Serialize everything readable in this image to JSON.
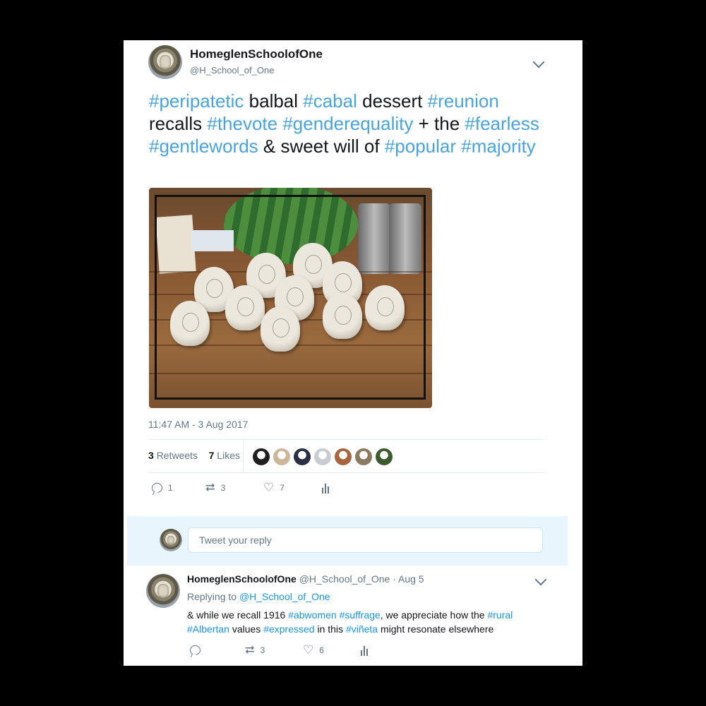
{
  "tweet": {
    "display_name": "HomeglenSchoolofOne",
    "handle": "@H_School_of_One",
    "text_parts": [
      {
        "t": "#peripatetic",
        "ht": true
      },
      {
        "t": " balbal ",
        "ht": false
      },
      {
        "t": "#cabal",
        "ht": true
      },
      {
        "t": " dessert ",
        "ht": false
      },
      {
        "t": "#reunion",
        "ht": true
      },
      {
        "t": " recalls ",
        "ht": false
      },
      {
        "t": "#thevote",
        "ht": true
      },
      {
        "t": " ",
        "ht": false
      },
      {
        "t": "#genderequality",
        "ht": true
      },
      {
        "t": " + the ",
        "ht": false
      },
      {
        "t": "#fearless",
        "ht": true
      },
      {
        "t": " ",
        "ht": false
      },
      {
        "t": "#gentlewords",
        "ht": true
      },
      {
        "t": " & sweet will of ",
        "ht": false
      },
      {
        "t": "#popular",
        "ht": true
      },
      {
        "t": " ",
        "ht": false
      },
      {
        "t": "#majority",
        "ht": true
      }
    ],
    "timestamp": "11:47 AM - 3 Aug 2017",
    "retweets_count": "3",
    "retweets_label": "Retweets",
    "likes_count": "7",
    "likes_label": "Likes",
    "likers_avatars": [
      "#1f1f1f",
      "#cdb79a",
      "#2a2f45",
      "#c9cdd2",
      "#a8643f",
      "#8a7a5f",
      "#3c5a2e"
    ],
    "actions": {
      "reply_count": "1",
      "retweet_count": "3",
      "like_count": "7"
    }
  },
  "reply_box": {
    "placeholder": "Tweet your reply"
  },
  "reply": {
    "display_name": "HomeglenSchoolofOne",
    "handle_time": "@H_School_of_One · Aug 5",
    "replying_label": "Replying to",
    "replying_handle": "@H_School_of_One",
    "text_parts": [
      {
        "t": "& while we recall 1916 ",
        "ht": false
      },
      {
        "t": "#abwomen",
        "ht": true
      },
      {
        "t": " ",
        "ht": false
      },
      {
        "t": "#suffrage",
        "ht": true
      },
      {
        "t": ", we appreciate how the ",
        "ht": false
      },
      {
        "t": "#rural",
        "ht": true
      },
      {
        "t": " ",
        "ht": false
      },
      {
        "t": "#Albertan",
        "ht": true
      },
      {
        "t": " values ",
        "ht": false
      },
      {
        "t": "#expressed",
        "ht": true
      },
      {
        "t": " in this ",
        "ht": false
      },
      {
        "t": "#viñeta",
        "ht": true
      },
      {
        "t": " might resonate elsewhere",
        "ht": false
      }
    ],
    "actions": {
      "reply_count": "",
      "retweet_count": "3",
      "like_count": "6"
    }
  }
}
